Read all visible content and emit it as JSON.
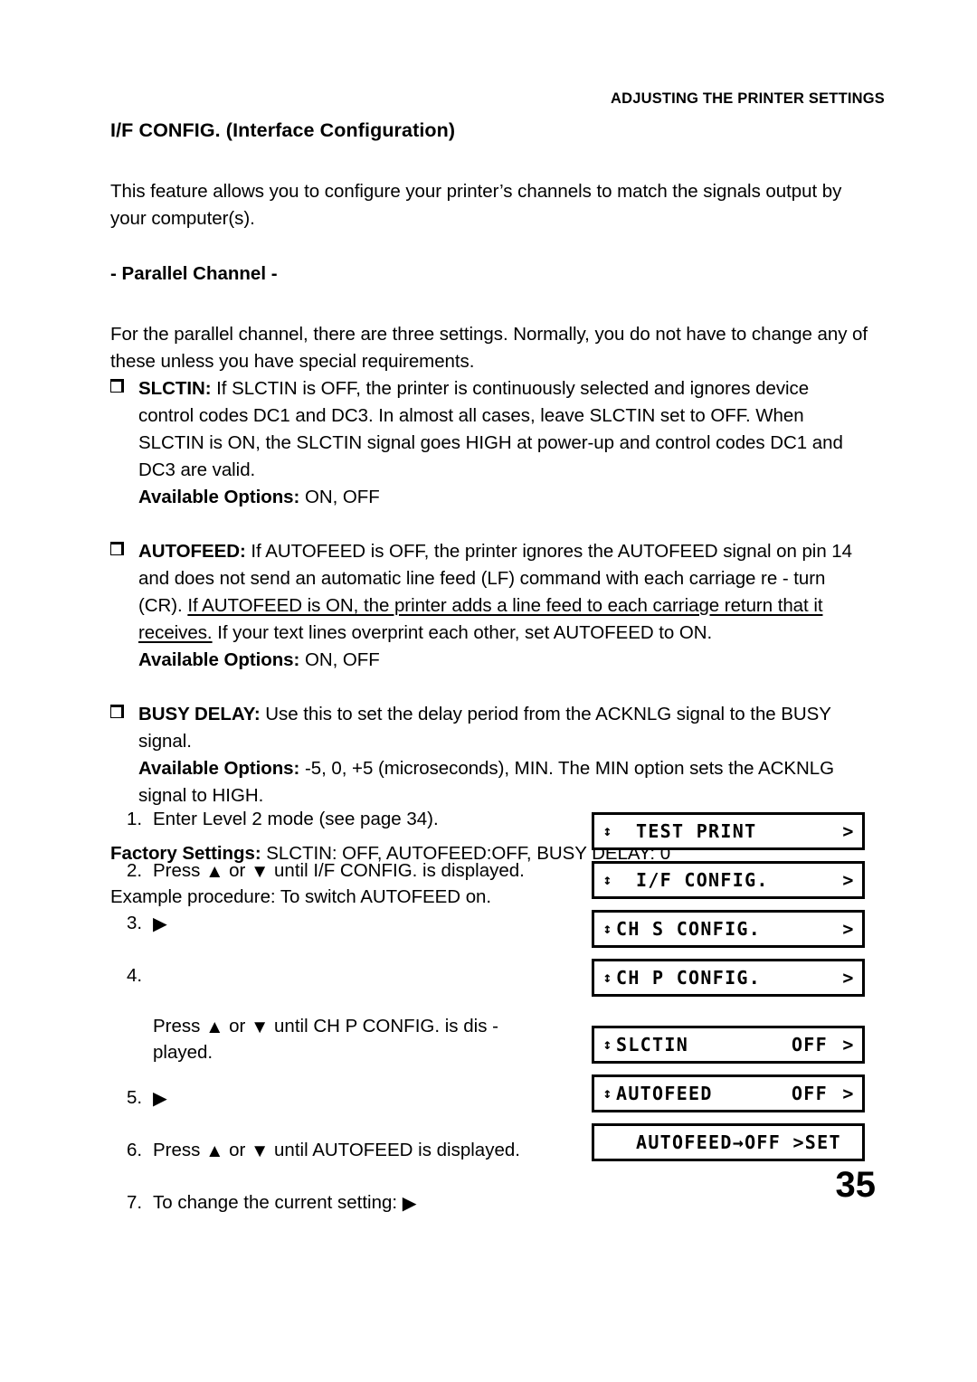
{
  "header": {
    "running_head": "ADJUSTING THE PRINTER SETTINGS"
  },
  "page": {
    "number": "35"
  },
  "section": {
    "title": "I/F CONFIG. (Interface Configuration)",
    "intro": "This feature allows you to configure your printer’s channels to match the signals output by your computer(s).",
    "subsection_title": "- Parallel Channel -",
    "subsection_intro": "For the parallel channel, there are three settings. Normally, you do not have to change any of these unless you have special requirements."
  },
  "bullets": [
    {
      "term": "SLCTIN:",
      "text": " If SLCTIN is OFF, the printer is continuously selected and ignores device control codes DC1 and DC3. In almost all cases, leave SLCTIN set to OFF. When SLCTIN is ON, the SLCTIN signal goes HIGH at power-up and control codes DC1 and DC3 are valid.",
      "options_label": "Available Options:",
      "options_value": " ON, OFF"
    },
    {
      "term": "AUTOFEED:",
      "text_before": " If AUTOFEED is OFF, the printer ignores the AUTOFEED signal on pin 14 and does not send an automatic line feed (LF) command with each carriage re - turn (CR). ",
      "text_underlined": "If AUTOFEED is ON, the printer adds a line feed to each carriage return that it receives.",
      "text_after": " If your text lines overprint each other, set AUTOFEED to ON.",
      "options_label": "Available Options:",
      "options_value": " ON, OFF"
    },
    {
      "term": "BUSY DELAY:",
      "text": " Use this to set the delay period from the ACKNLG signal to the BUSY signal.",
      "options_label": "Available Options:",
      "options_value": " -5, 0, +5 (microseconds), MIN. The MIN option sets the ACKNLG signal to HIGH."
    }
  ],
  "factory": {
    "label": "Factory Settings:",
    "value": " SLCTIN: OFF, AUTOFEED:OFF, BUSY DELAY: 0"
  },
  "procedure": {
    "intro": "Example procedure: To switch AUTOFEED on.",
    "steps": [
      {
        "num": "1.",
        "text": "Enter Level 2 mode (see page  34)."
      },
      {
        "num": "2.",
        "pre": "Press ",
        "up": "▲",
        "mid": " or ",
        "down": "▼",
        "post": " until I/F CONFIG. is displayed."
      },
      {
        "num": "3.",
        "right": "▶"
      },
      {
        "num": "4.",
        "pre": "Press ",
        "up": "▲",
        "mid": " or ",
        "down": "▼",
        "post": " until CH P CONFIG. is dis -\nplayed."
      },
      {
        "num": "5.",
        "right": "▶"
      },
      {
        "num": "6.",
        "pre": "Press ",
        "up": "▲",
        "mid": " or ",
        "down": "▼",
        "post": " until AUTOFEED is displayed."
      },
      {
        "num": "7.",
        "pre": "To change the current setting:  ",
        "right": "▶"
      }
    ]
  },
  "lcd_panels": [
    {
      "updown": "↕",
      "label": "TEST PRINT",
      "value": "",
      "chevron": ">",
      "indent": true
    },
    {
      "updown": "↕",
      "label": "I/F CONFIG.",
      "value": "",
      "chevron": ">",
      "indent": true
    },
    {
      "updown": "↕",
      "label": "CH S CONFIG.",
      "value": "",
      "chevron": ">",
      "indent": false
    },
    {
      "updown": "↕",
      "label": "CH P CONFIG.",
      "value": "",
      "chevron": ">",
      "indent": false
    },
    {
      "updown": "↕",
      "label": "SLCTIN",
      "value": "OFF",
      "chevron": ">",
      "indent": false
    },
    {
      "updown": "↕",
      "label": "AUTOFEED",
      "value": "OFF",
      "chevron": ">",
      "indent": false
    },
    {
      "updown": "",
      "label": "AUTOFEED",
      "value": "→OFF >SET",
      "chevron": "",
      "indent": true
    }
  ]
}
